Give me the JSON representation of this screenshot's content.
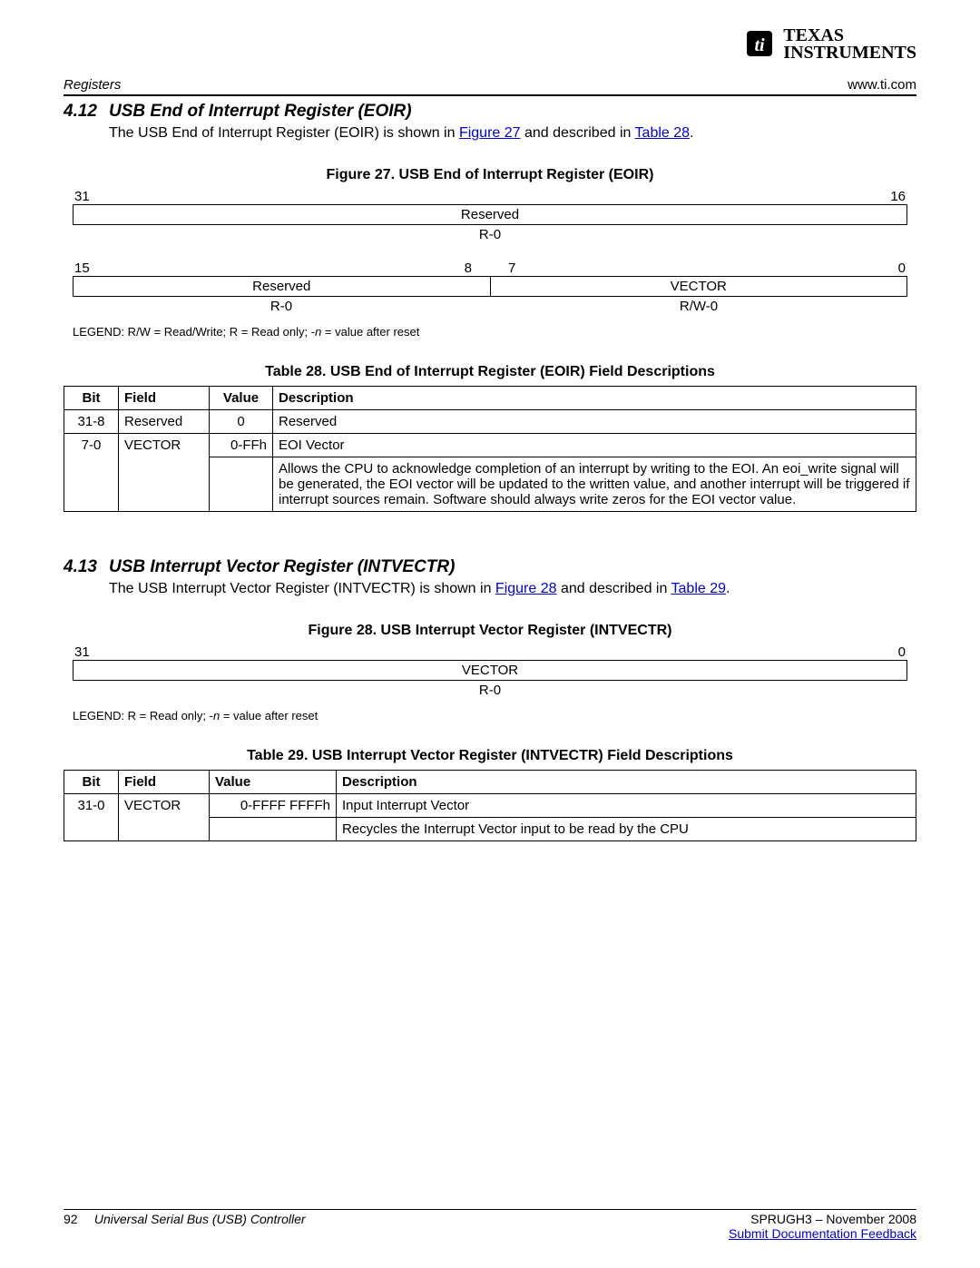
{
  "header": {
    "left": "Registers",
    "right": "www.ti.com"
  },
  "logo": {
    "line1": "TEXAS",
    "line2": "INSTRUMENTS"
  },
  "section_412": {
    "num": "4.12",
    "title": "USB End of Interrupt Register (EOIR)",
    "intro_pre": "The USB End of Interrupt Register (EOIR) is shown in ",
    "fig_link": "Figure 27",
    "intro_mid": " and described in ",
    "tbl_link": "Table 28",
    "intro_post": "."
  },
  "fig27": {
    "title": "Figure 27. USB End of Interrupt Register (EOIR)",
    "row1_bit_hi": "31",
    "row1_bit_lo": "16",
    "row1_field": "Reserved",
    "row1_rw": "R-0",
    "row2_bit_hi": "15",
    "row2_bit_mid1": "8",
    "row2_bit_mid2": "7",
    "row2_bit_lo": "0",
    "row2_field1": "Reserved",
    "row2_field2": "VECTOR",
    "row2_rw1": "R-0",
    "row2_rw2": "R/W-0",
    "legend_pre": "LEGEND: R/W = Read/Write; R = Read only; -",
    "legend_ital": "n",
    "legend_post": " = value after reset"
  },
  "table28": {
    "title": "Table 28. USB End of Interrupt Register (EOIR) Field Descriptions",
    "h_bit": "Bit",
    "h_field": "Field",
    "h_value": "Value",
    "h_desc": "Description",
    "r1_bit": "31-8",
    "r1_field": "Reserved",
    "r1_value": "0",
    "r1_desc": "Reserved",
    "r2_bit": "7-0",
    "r2_field": "VECTOR",
    "r2_value": "0-FFh",
    "r2_desc": "EOI Vector",
    "r3_desc": "Allows the CPU to acknowledge completion of an interrupt by writing to the EOI. An eoi_write signal will be generated, the EOI vector will be updated to the written value, and another interrupt will be triggered if interrupt sources remain. Software should always write zeros for the EOI vector value."
  },
  "section_413": {
    "num": "4.13",
    "title": "USB Interrupt Vector Register (INTVECTR)",
    "intro_pre": "The USB Interrupt Vector Register (INTVECTR) is shown in ",
    "fig_link": "Figure 28",
    "intro_mid": " and described in ",
    "tbl_link": "Table 29",
    "intro_post": "."
  },
  "fig28": {
    "title": "Figure 28. USB Interrupt Vector Register (INTVECTR)",
    "bit_hi": "31",
    "bit_lo": "0",
    "field": "VECTOR",
    "rw": "R-0",
    "legend_pre": "LEGEND: R = Read only; -",
    "legend_ital": "n",
    "legend_post": " = value after reset"
  },
  "table29": {
    "title": "Table 29. USB Interrupt Vector Register (INTVECTR) Field Descriptions",
    "h_bit": "Bit",
    "h_field": "Field",
    "h_value": "Value",
    "h_desc": "Description",
    "r1_bit": "31-0",
    "r1_field": "VECTOR",
    "r1_value": "0-FFFF FFFFh",
    "r1_desc": "Input Interrupt Vector",
    "r2_desc": "Recycles the Interrupt Vector input to be read by the CPU"
  },
  "footer": {
    "page": "92",
    "doc": "Universal Serial Bus (USB) Controller",
    "right1": "SPRUGH3 – November 2008",
    "right2": "Submit Documentation Feedback"
  }
}
